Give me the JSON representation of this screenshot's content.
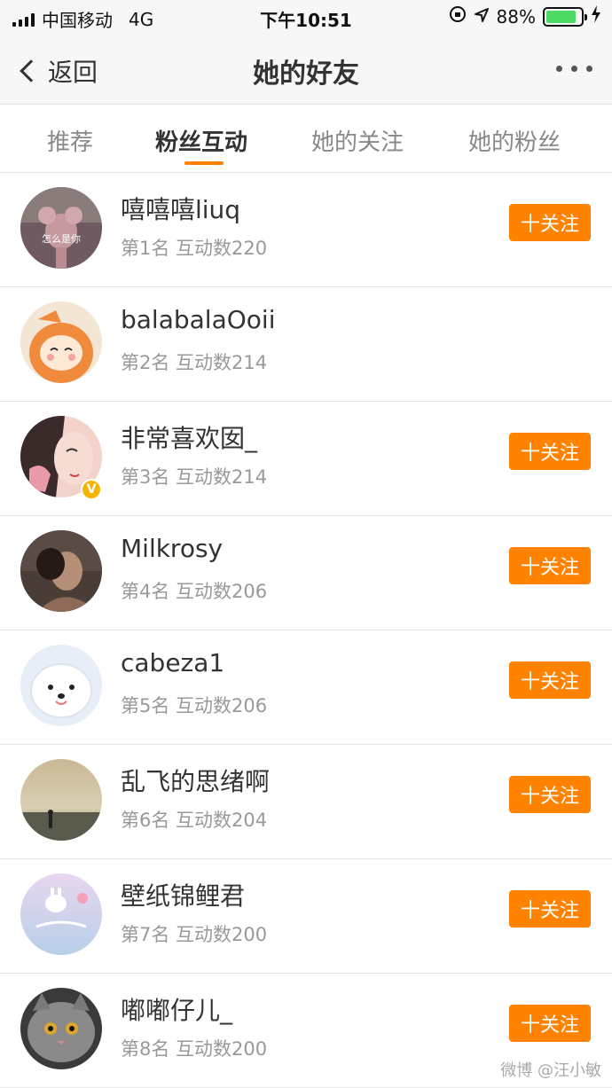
{
  "status": {
    "carrier": "中国移动",
    "network": "4G",
    "time": "下午10:51",
    "battery": "88%",
    "battery_level": 0.88
  },
  "nav": {
    "back_label": "返回",
    "title": "她的好友"
  },
  "tabs": [
    {
      "label": "推荐",
      "active": false
    },
    {
      "label": "粉丝互动",
      "active": true
    },
    {
      "label": "她的关注",
      "active": false
    },
    {
      "label": "她的粉丝",
      "active": false
    }
  ],
  "friends": [
    {
      "name": "嘻嘻嘻liuq",
      "meta": "第1名 互动数220",
      "follow": "十关注",
      "show_follow": true,
      "avatar_caption": "怎么是你"
    },
    {
      "name": "balabalaOoii",
      "meta": "第2名 互动数214",
      "follow": "",
      "show_follow": false
    },
    {
      "name": "非常喜欢囡_",
      "meta": "第3名 互动数214",
      "follow": "十关注",
      "show_follow": true,
      "verified": "V"
    },
    {
      "name": "Milkrosy",
      "meta": "第4名 互动数206",
      "follow": "十关注",
      "show_follow": true
    },
    {
      "name": "cabeza1",
      "meta": "第5名 互动数206",
      "follow": "十关注",
      "show_follow": true
    },
    {
      "name": "乱飞的思绪啊",
      "meta": "第6名 互动数204",
      "follow": "十关注",
      "show_follow": true
    },
    {
      "name": "壁纸锦鲤君",
      "meta": "第7名 互动数200",
      "follow": "十关注",
      "show_follow": true
    },
    {
      "name": "嘟嘟仔儿_",
      "meta": "第8名 互动数200",
      "follow": "十关注",
      "show_follow": true
    }
  ],
  "watermark": "微博 @汪小敏",
  "colors": {
    "accent": "#ff8200",
    "battery": "#4cd964",
    "verified": "#f5b400"
  }
}
